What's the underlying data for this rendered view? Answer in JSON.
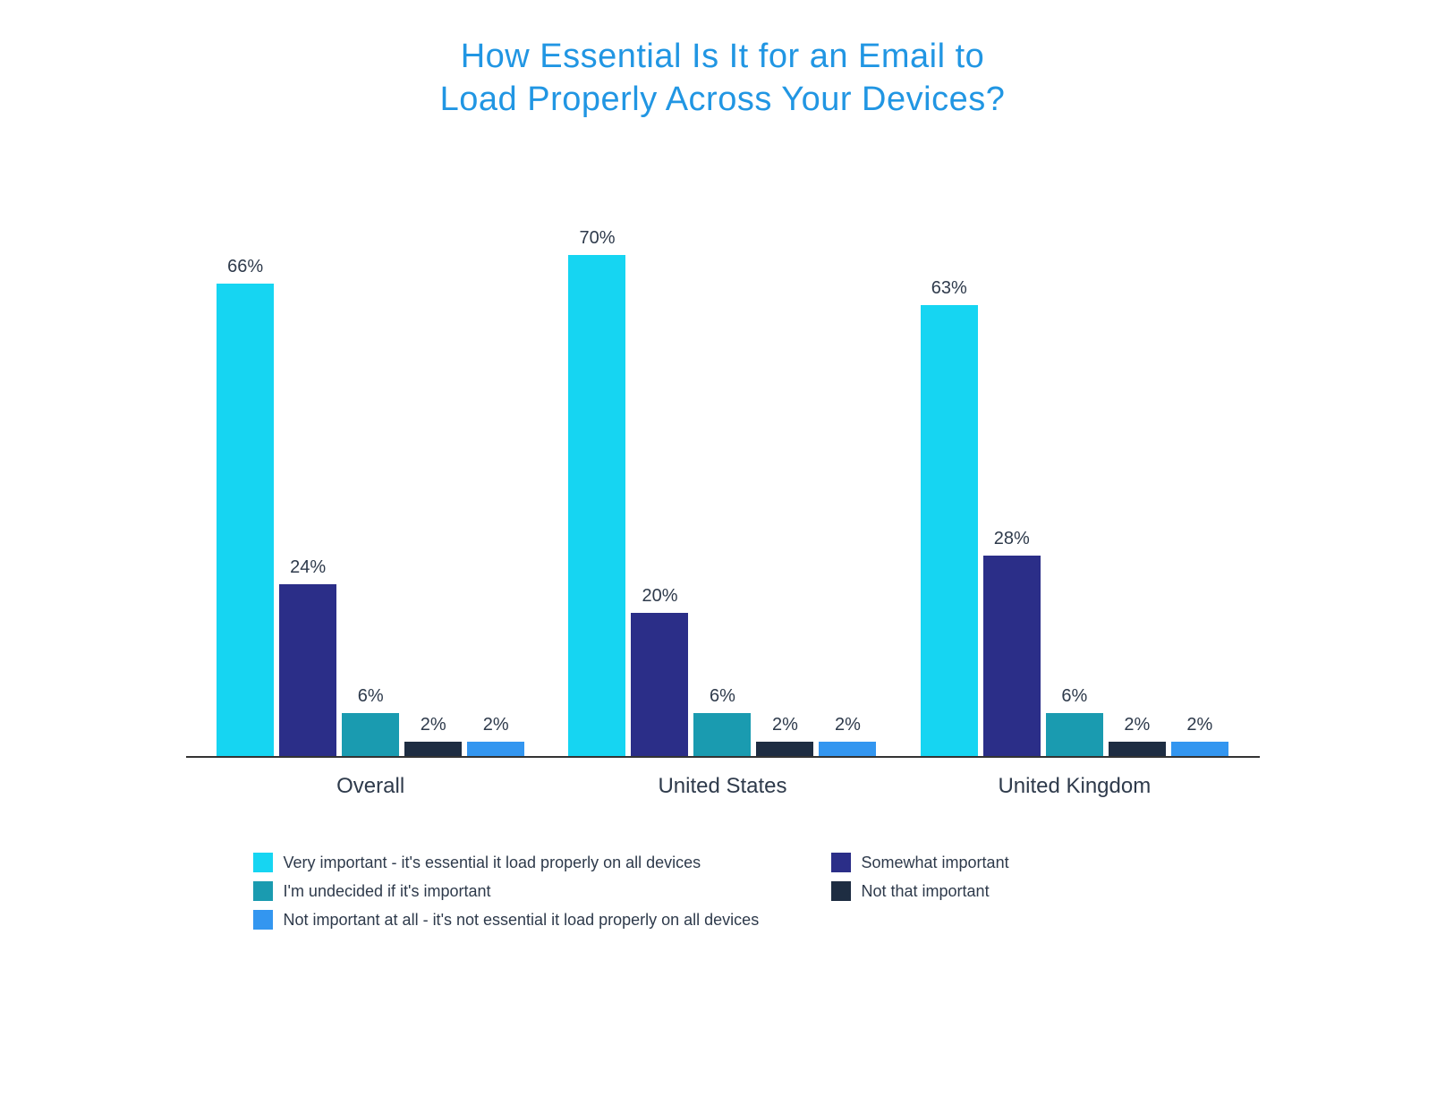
{
  "chart_data": {
    "type": "bar",
    "title": "How Essential Is It for an Email to\nLoad Properly Across Your Devices?",
    "categories": [
      "Overall",
      "United States",
      "United Kingdom"
    ],
    "series": [
      {
        "name": "Very important - it's essential it load properly on all devices",
        "color": "#16d5f2",
        "values": [
          66,
          70,
          63
        ]
      },
      {
        "name": "Somewhat important",
        "color": "#2b2e88",
        "values": [
          24,
          20,
          28
        ]
      },
      {
        "name": "I'm undecided if it's important",
        "color": "#1a9bb0",
        "values": [
          6,
          6,
          6
        ]
      },
      {
        "name": "Not that important",
        "color": "#1e2d42",
        "values": [
          2,
          2,
          2
        ]
      },
      {
        "name": "Not important at all - it's not essential it load properly on all devices",
        "color": "#3396f0",
        "values": [
          2,
          2,
          2
        ]
      }
    ],
    "ylim": [
      0,
      80
    ],
    "units": "%",
    "legend_position": "bottom"
  }
}
